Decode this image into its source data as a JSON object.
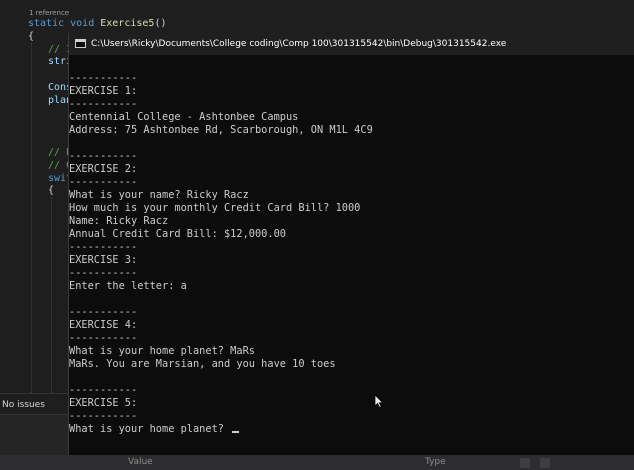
{
  "editor": {
    "references": "1 reference",
    "signature": {
      "modifiers": "static void ",
      "method": "Exercise5",
      "parens": "()"
    },
    "brace_open": "{",
    "fragments": {
      "comment1": "// I",
      "stri": "stri",
      "cons": "Cons",
      "plan": "plan",
      "comment2": "// E",
      "comment3": "// C",
      "swit": "swit",
      "brace2": "{"
    }
  },
  "status_bar": {
    "text": "No issues found"
  },
  "bottom_panel": {
    "col_value": "Value",
    "col_type": "Type"
  },
  "console": {
    "title": "C:\\Users\\Ricky\\Documents\\College coding\\Comp 100\\301315542\\bin\\Debug\\301315542.exe",
    "lines": [
      "-----------",
      "EXERCISE 1:",
      "-----------",
      "Centennial College - Ashtonbee Campus",
      "Address: 75 Ashtonbee Rd, Scarborough, ON M1L 4C9",
      "",
      "-----------",
      "EXERCISE 2:",
      "-----------",
      "What is your name? Ricky Racz",
      "How much is your monthly Credit Card Bill? 1000",
      "Name: Ricky Racz",
      "Annual Credit Card Bill: $12,000.00",
      "-----------",
      "EXERCISE 3:",
      "-----------",
      "Enter the letter: a",
      "",
      "-----------",
      "EXERCISE 4:",
      "-----------",
      "What is your home planet? MaRs",
      "MaRs. You are Marsian, and you have 10 toes",
      "",
      "-----------",
      "EXERCISE 5:",
      "-----------",
      "What is your home planet? "
    ]
  }
}
